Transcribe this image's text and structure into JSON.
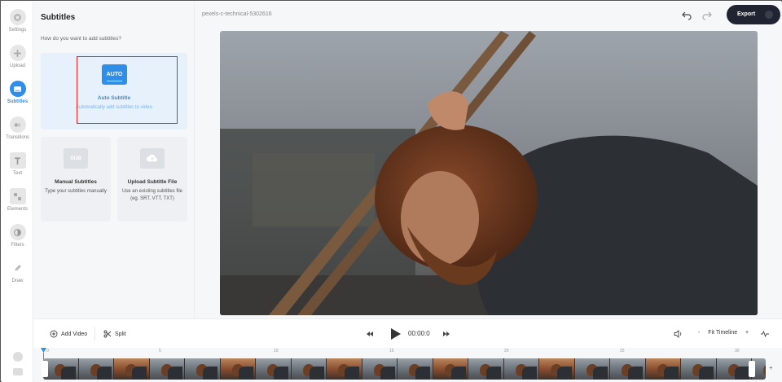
{
  "sidebar": {
    "items": [
      {
        "label": "Settings",
        "icon": "gear-icon"
      },
      {
        "label": "Upload",
        "icon": "plus-icon"
      },
      {
        "label": "Subtitles",
        "icon": "subtitles-icon",
        "active": true
      },
      {
        "label": "Transitions",
        "icon": "transitions-icon"
      },
      {
        "label": "Text",
        "icon": "text-icon"
      },
      {
        "label": "Elements",
        "icon": "elements-icon"
      },
      {
        "label": "Filters",
        "icon": "filters-icon"
      },
      {
        "label": "Draw",
        "icon": "pencil-icon"
      }
    ],
    "bottom_icons": [
      "help-icon",
      "keyboard-icon"
    ]
  },
  "panel": {
    "title": "Subtitles",
    "question": "How do you want to add subtitles?",
    "auto": {
      "badge": "AUTO",
      "title": "Auto Subtitle",
      "desc": "Automatically add subtitles to video"
    },
    "manual": {
      "badge": "SUB",
      "title": "Manual Subtitles",
      "desc": "Type your subtitles manually"
    },
    "upload": {
      "title": "Upload Subtitle File",
      "desc": "Use an existing subtitles file (eg. SRT, VTT, TXT)"
    }
  },
  "header": {
    "file_name": "pexels-c-technical-5302616",
    "export_label": "Export"
  },
  "controls": {
    "add_video": "Add Video",
    "split": "Split",
    "timecode": "00:00:0",
    "fit_timeline": "Fit Timeline"
  },
  "timeline": {
    "ticks": [
      "0",
      "5",
      "10",
      "15",
      "20",
      "25",
      "30"
    ]
  },
  "colors": {
    "accent": "#2f8fe8",
    "highlight_box": "#e22929",
    "export_bg": "#1f2430"
  }
}
